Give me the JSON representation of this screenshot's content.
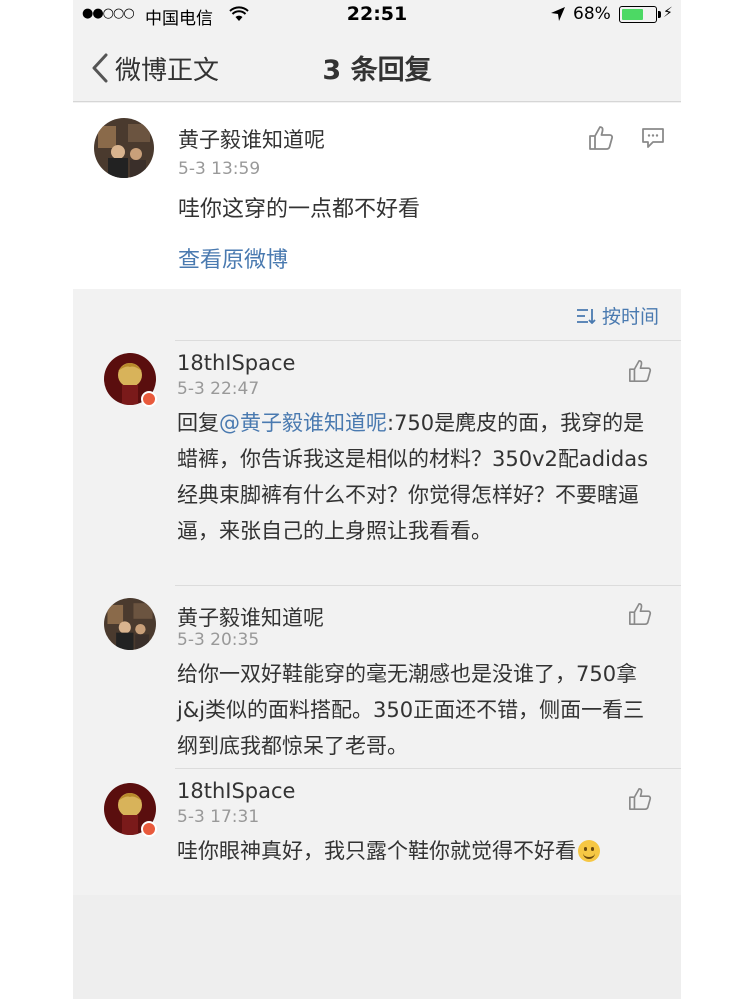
{
  "status_bar": {
    "signal": "●●○○○",
    "carrier": "中国电信",
    "time": "22:51",
    "battery_text": "68%",
    "battery_level": 0.68,
    "battery_color": "#4cd964"
  },
  "nav": {
    "back_label": "微博正文",
    "title": "3 条回复"
  },
  "original_comment": {
    "username": "黄子毅谁知道呢",
    "time": "5-3 13:59",
    "text": "哇你这穿的一点都不好看",
    "view_original": "查看原微博"
  },
  "sort": {
    "label": "按时间"
  },
  "replies": [
    {
      "username": "18thISpace",
      "time": "5-3 22:47",
      "prefix": "回复",
      "mention": "@黄子毅谁知道呢",
      "text": ":750是麂皮的面，我穿的是蜡裤，你告诉我这是相似的材料？350v2配adidas经典束脚裤有什么不对？你觉得怎样好？不要瞎逼逼，来张自己的上身照让我看看。"
    },
    {
      "username": "黄子毅谁知道呢",
      "time": "5-3 20:35",
      "text": "给你一双好鞋能穿的毫无潮感也是没谁了，750拿j&j类似的面料搭配。350正面还不错，侧面一看三纲到底我都惊呆了老哥。"
    },
    {
      "username": "18thISpace",
      "time": "5-3 17:31",
      "text": "哇你眼神真好，我只露个鞋你就觉得不好看"
    }
  ],
  "colors": {
    "link": "#4a7ab0",
    "background": "#f2f2f2",
    "icon": "#8a8a8a"
  },
  "icons": [
    "chevron-left-icon",
    "wifi-icon",
    "location-arrow-icon",
    "battery-icon",
    "thumbs-up-icon",
    "comment-icon",
    "sort-icon",
    "verified-badge-icon",
    "smile-emoji-icon"
  ]
}
